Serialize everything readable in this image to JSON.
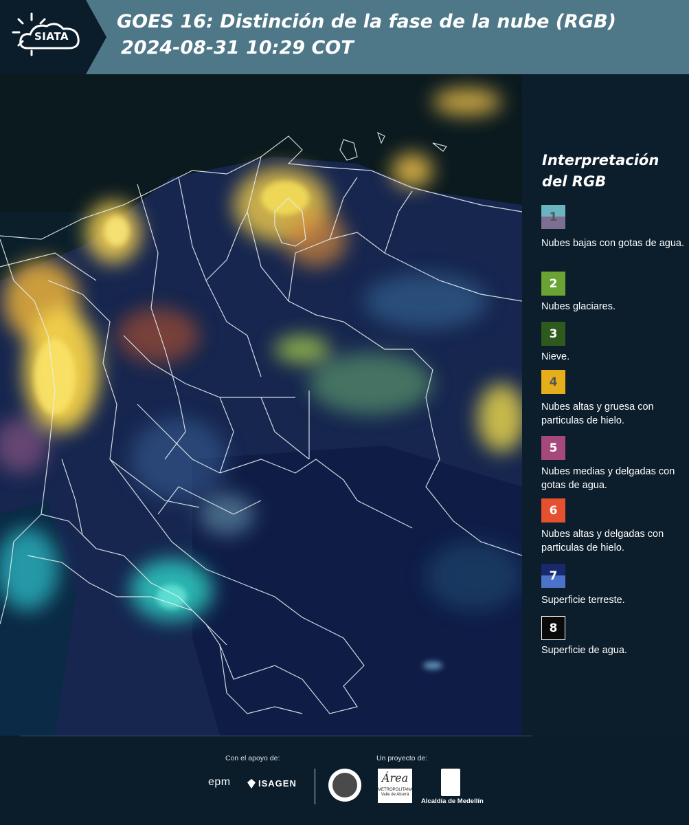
{
  "header": {
    "logo_text": "SIATA",
    "title_line1": "GOES 16: Distinción de la fase de la nube (RGB)",
    "title_line2": "2024-08-31 10:29 COT",
    "background_color": "#4e7787"
  },
  "legend": {
    "title": "Interpretación del RGB",
    "items": [
      {
        "number": "1",
        "description": "Nubes bajas con gotas de agua.",
        "color_top": "#6ab3c1",
        "color_bottom": "#7d6f92",
        "text_color": "#555555"
      },
      {
        "number": "2",
        "description": "Nubes glaciares.",
        "color": "#6aa234",
        "text_color": "#ffffff"
      },
      {
        "number": "3",
        "description": "Nieve.",
        "color": "#2f5a1e",
        "text_color": "#ffffff"
      },
      {
        "number": "4",
        "description": "Nubes altas y gruesa con particulas de hielo.",
        "color": "#e7ae1c",
        "text_color": "#555555"
      },
      {
        "number": "5",
        "description": "Nubes medias y delgadas con gotas de agua.",
        "color": "#a5497d",
        "text_color": "#ffffff"
      },
      {
        "number": "6",
        "description": "Nubes altas y delgadas con particulas de hielo.",
        "color": "#e5502e",
        "text_color": "#ffffff"
      },
      {
        "number": "7",
        "description": "Superficie terreste.",
        "color_top": "#17296a",
        "color_bottom": "#4d72c9",
        "text_color": "#ffffff"
      },
      {
        "number": "8",
        "description": "Superficie de agua.",
        "color": "#0a0a0a",
        "text_color": "#ffffff",
        "border_color": "#ffffff"
      }
    ]
  },
  "footer": {
    "support_label": "Con el apoyo de:",
    "project_label": "Un proyecto de:",
    "sponsor_epm": "epm",
    "sponsor_isagen": "ISAGEN",
    "area_logo_text": "Área",
    "area_logo_sub": "METROPOLITANA Valle de Aburrá",
    "medellin_label": "Alcaldía de Medellín"
  }
}
